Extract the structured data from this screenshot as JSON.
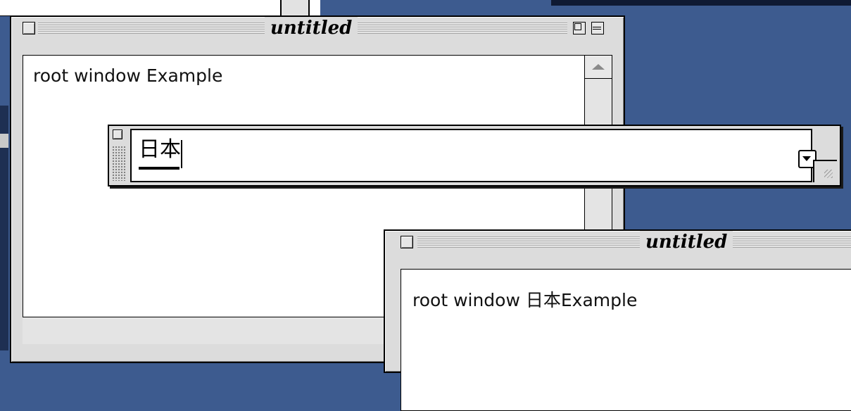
{
  "colors": {
    "desktop": "#3d5b8f",
    "platinum": "#dcdcdc"
  },
  "window1": {
    "title": "untitled",
    "text": "root window Example",
    "icons": [
      "close-box-icon",
      "zoom-box-icon",
      "collapse-box-icon",
      "scroll-up-arrow-icon"
    ]
  },
  "palette": {
    "composing_text": "日本",
    "icons": [
      "close-box-icon",
      "dropdown-arrow-icon",
      "grow-box-icon"
    ]
  },
  "window2": {
    "title": "untitled",
    "text": "root window 日本Example",
    "icons": [
      "close-box-icon"
    ]
  }
}
